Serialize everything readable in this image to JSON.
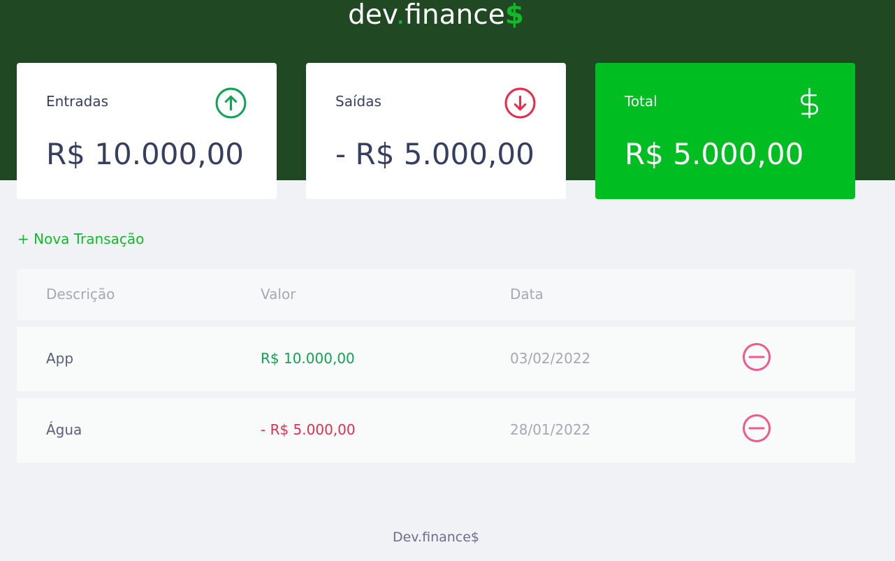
{
  "header": {
    "logo_part1": "dev",
    "logo_dot": ".",
    "logo_part2": "finance",
    "logo_dollar": "$"
  },
  "cards": {
    "income": {
      "label": "Entradas",
      "amount": "R$ 10.000,00",
      "icon": "arrow-up-circle-icon"
    },
    "expense": {
      "label": "Saídas",
      "amount": "- R$ 5.000,00",
      "icon": "arrow-down-circle-icon"
    },
    "total": {
      "label": "Total",
      "amount": "R$ 5.000,00",
      "icon": "dollar-sign-icon"
    }
  },
  "new_transaction_label": "+ Nova Transação",
  "table": {
    "headers": [
      "Descrição",
      "Valor",
      "Data"
    ],
    "rows": [
      {
        "description": "App",
        "amount": "R$ 10.000,00",
        "date": "03/02/2022",
        "type": "income"
      },
      {
        "description": "Água",
        "amount": "- R$ 5.000,00",
        "date": "28/01/2022",
        "type": "expense"
      }
    ]
  },
  "footer": "Dev.finance$",
  "colors": {
    "header_bg": "#1f4823",
    "accent_green": "#12b928",
    "total_card_bg": "#00bd21",
    "income_text": "#12a454",
    "expense_text": "#e52e4d",
    "remove_icon": "#f0598a"
  }
}
